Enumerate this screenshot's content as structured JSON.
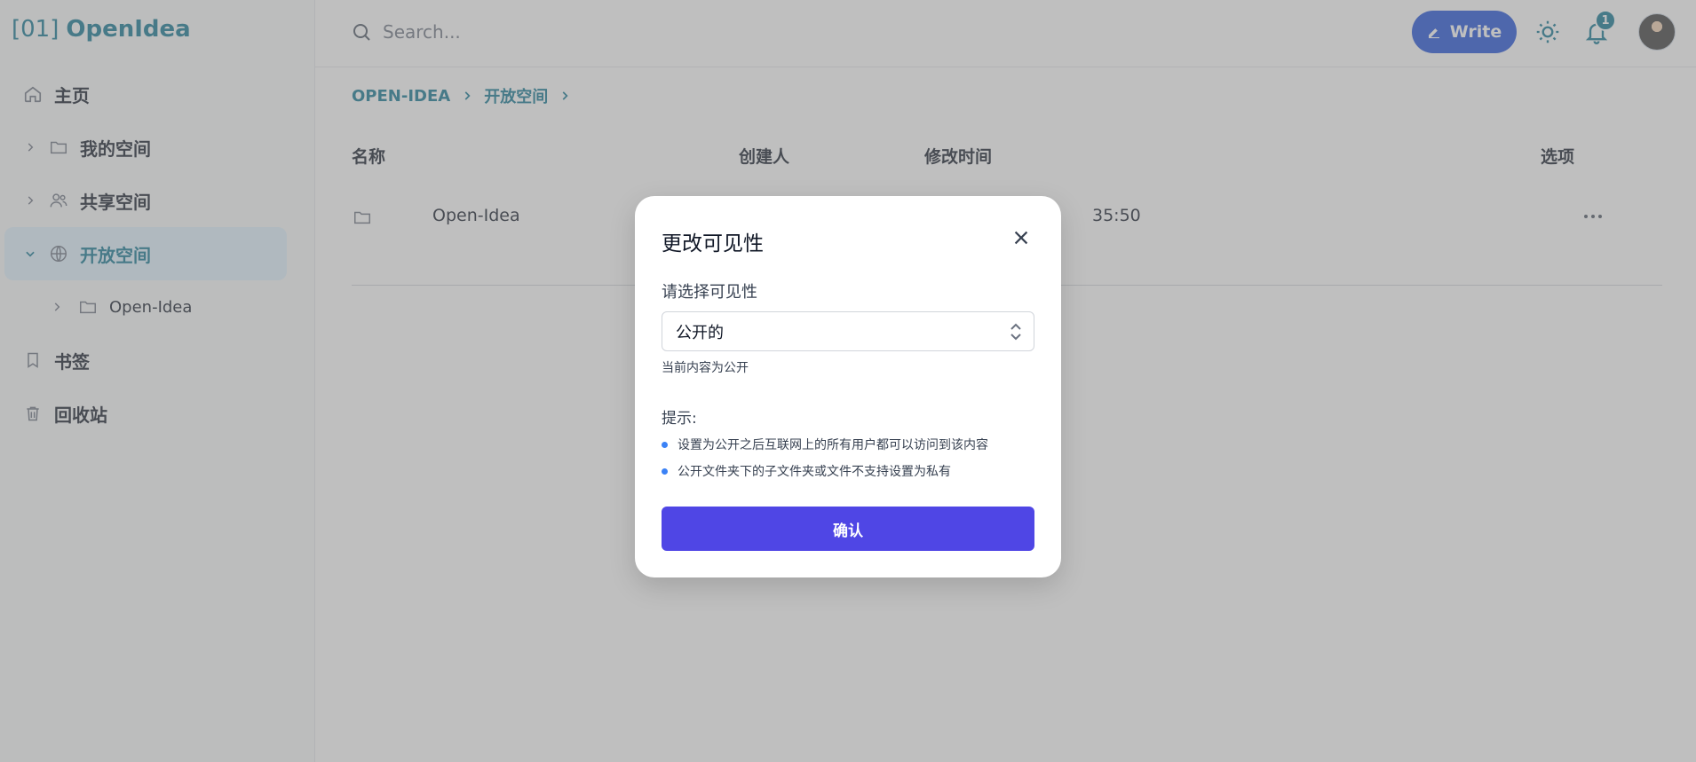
{
  "brand": {
    "code": "[01]",
    "name": "OpenIdea"
  },
  "sidebar": {
    "items": [
      {
        "label": "主页",
        "icon": "home-icon"
      },
      {
        "label": "我的空间",
        "icon": "folder-icon"
      },
      {
        "label": "共享空间",
        "icon": "users-icon"
      },
      {
        "label": "开放空间",
        "icon": "globe-icon",
        "active": true
      },
      {
        "label": "Open-Idea",
        "icon": "folder-icon"
      },
      {
        "label": "书签",
        "icon": "bookmark-icon"
      },
      {
        "label": "回收站",
        "icon": "trash-icon"
      }
    ]
  },
  "topbar": {
    "search_placeholder": "Search...",
    "write_label": "Write",
    "notifications_count": "1"
  },
  "breadcrumb": {
    "items": [
      "OPEN-IDEA",
      "开放空间"
    ]
  },
  "table": {
    "headers": [
      "名称",
      "创建人",
      "修改时间",
      "选项"
    ],
    "rows": [
      {
        "name": "Open-Idea",
        "modified": "35:50"
      }
    ]
  },
  "modal": {
    "title": "更改可见性",
    "field_label": "请选择可见性",
    "selected": "公开的",
    "helper": "当前内容为公开",
    "tips_title": "提示:",
    "tips": [
      "设置为公开之后互联网上的所有用户都可以访问到该内容",
      "公开文件夹下的子文件夹或文件不支持设置为私有"
    ],
    "confirm_label": "确认"
  },
  "colors": {
    "brand": "#0e7490",
    "write_button": "#1d4ed8",
    "confirm_button": "#4f46e5",
    "tip_bullet": "#3b82f6",
    "overlay": "rgba(128,128,128,0.5)"
  }
}
